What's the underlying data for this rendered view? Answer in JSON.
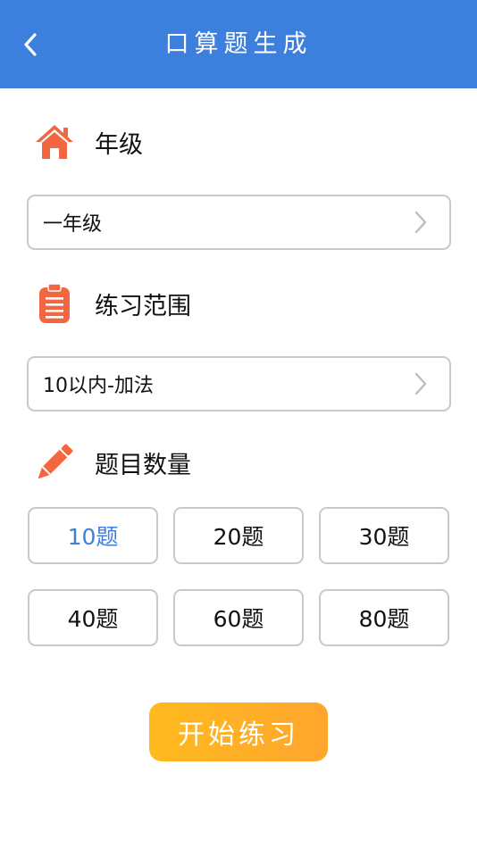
{
  "header": {
    "title": "口算题生成"
  },
  "grade": {
    "title": "年级",
    "value": "一年级"
  },
  "range": {
    "title": "练习范围",
    "value": "10以内-加法"
  },
  "count": {
    "title": "题目数量",
    "options": [
      "10题",
      "20题",
      "30题",
      "40题",
      "60题",
      "80题"
    ],
    "selected": "10题"
  },
  "start_label": "开始练习",
  "colors": {
    "primary": "#3d7fdd",
    "accent_icon": "#f2673f",
    "start_gradient": [
      "#ffba1e",
      "#ffa62e"
    ]
  }
}
